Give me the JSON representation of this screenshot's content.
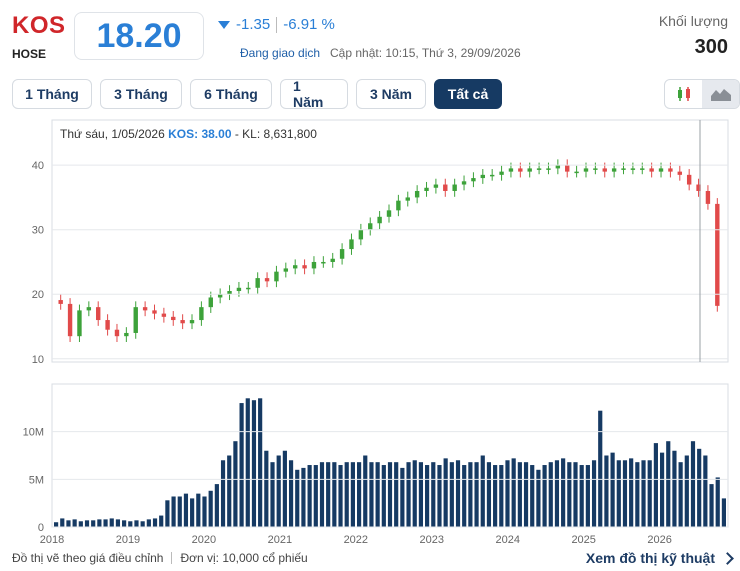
{
  "header": {
    "ticker": "KOS",
    "exchange": "HOSE",
    "price": "18.20",
    "change": "-1.35",
    "change_pct": "-6.91 %",
    "status": "Đang giao dịch",
    "updated": "Cập nhật: 10:15, Thứ 3, 29/09/2026",
    "volume_label": "Khối lượng",
    "volume_value": "300"
  },
  "tabs": [
    {
      "label": "1 Tháng",
      "active": false
    },
    {
      "label": "3 Tháng",
      "active": false
    },
    {
      "label": "6 Tháng",
      "active": false
    },
    {
      "label": "1 Năm",
      "active": false
    },
    {
      "label": "3 Năm",
      "active": false
    },
    {
      "label": "Tất cả",
      "active": true
    }
  ],
  "chart_toggle": [
    {
      "icon": "candlestick-icon",
      "active": false
    },
    {
      "icon": "area-chart-icon",
      "active": true
    }
  ],
  "tooltip": {
    "date": "Thứ sáu, 1/05/2026",
    "value": "KOS: 38.00",
    "volume": "- KL: 8,631,800"
  },
  "colors": {
    "up": "#3da23a",
    "down": "#e14a4a",
    "volume": "#163a63",
    "accent": "#2a7fd6"
  },
  "chart_data": {
    "type": "candlestick",
    "x": [
      2018.0,
      2018.08,
      2018.17,
      2018.25,
      2018.33,
      2018.42,
      2018.5,
      2018.58,
      2018.67,
      2018.75,
      2018.83,
      2018.92,
      2019.0,
      2019.08,
      2019.17,
      2019.25,
      2019.33,
      2019.42,
      2019.5,
      2019.58,
      2019.67,
      2019.75,
      2019.83,
      2019.92,
      2020.0,
      2020.08,
      2020.17,
      2020.25,
      2020.33,
      2020.42,
      2020.5,
      2020.58,
      2020.67,
      2020.75,
      2020.83,
      2020.92,
      2021.0,
      2021.08,
      2021.17,
      2021.25,
      2021.33,
      2021.42,
      2021.5,
      2021.58,
      2021.67,
      2021.75,
      2021.83,
      2021.92,
      2022.0,
      2022.08,
      2022.17,
      2022.25,
      2022.33,
      2022.42,
      2022.5,
      2022.58,
      2022.67,
      2022.75,
      2022.83,
      2022.92,
      2023.0,
      2023.08,
      2023.17,
      2023.25,
      2023.33,
      2023.42,
      2023.5,
      2023.58,
      2023.67,
      2023.75,
      2023.83,
      2023.92,
      2024.0,
      2024.08,
      2024.17,
      2024.25,
      2024.33,
      2024.42,
      2024.5,
      2024.58,
      2024.67,
      2024.75,
      2024.83,
      2024.92,
      2025.0,
      2025.08,
      2025.17,
      2025.25,
      2025.33,
      2025.42,
      2025.5,
      2025.58,
      2025.67,
      2025.75,
      2025.83,
      2025.92,
      2026.0,
      2026.08,
      2026.17,
      2026.25,
      2026.33,
      2026.42,
      2026.5,
      2026.58,
      2026.67,
      2026.75
    ],
    "close": [
      18.5,
      13.5,
      17.5,
      18.0,
      16.0,
      14.5,
      13.5,
      14.0,
      18.0,
      17.5,
      17.0,
      16.5,
      16.0,
      15.5,
      16.0,
      18.0,
      19.5,
      20.0,
      20.5,
      21.0,
      21.0,
      22.5,
      22.0,
      23.5,
      24.0,
      24.5,
      24.0,
      25.0,
      25.0,
      25.5,
      27.0,
      28.5,
      30.0,
      31.0,
      32.0,
      33.0,
      34.5,
      35.0,
      36.0,
      36.5,
      37.0,
      36.0,
      37.0,
      37.5,
      38.0,
      38.5,
      38.5,
      39.0,
      39.5,
      39.0,
      39.5,
      39.5,
      39.5,
      40.0,
      39.0,
      39.0,
      39.5,
      39.5,
      39.0,
      39.5,
      39.5,
      39.5,
      39.5,
      39.0,
      39.5,
      39.0,
      38.5,
      37.0,
      36.0,
      34.0,
      18.2
    ],
    "note_x_ticks": [
      "2018",
      "2019",
      "2020",
      "2021",
      "2022",
      "2023",
      "2024",
      "2025",
      "2026"
    ],
    "y_ticks": [
      "10",
      "20",
      "30",
      "40"
    ],
    "volume_ticks": [
      "0",
      "5M",
      "10M"
    ],
    "volumes": [
      0.5,
      0.9,
      0.7,
      0.8,
      0.6,
      0.7,
      0.7,
      0.8,
      0.8,
      0.9,
      0.8,
      0.7,
      0.6,
      0.7,
      0.6,
      0.8,
      0.9,
      1.2,
      2.8,
      3.2,
      3.2,
      3.5,
      3.0,
      3.5,
      3.2,
      3.8,
      4.5,
      7.0,
      7.5,
      9.0,
      13.0,
      13.5,
      13.3,
      13.5,
      8.0,
      6.8,
      7.5,
      8.0,
      7.0,
      6.0,
      6.2,
      6.5,
      6.5,
      6.8,
      6.8,
      6.8,
      6.5,
      6.8,
      6.8,
      6.8,
      7.5,
      6.8,
      6.8,
      6.5,
      6.8,
      6.8,
      6.2,
      6.8,
      7.0,
      6.8,
      6.5,
      6.8,
      6.5,
      7.2,
      6.8,
      7.0,
      6.5,
      6.8,
      6.8,
      7.5,
      6.8,
      6.5,
      6.5,
      7.0,
      7.2,
      6.8,
      6.8,
      6.5,
      6.0,
      6.5,
      6.8,
      7.0,
      7.2,
      6.8,
      6.8,
      6.5,
      6.5,
      7.0,
      12.2,
      7.5,
      7.8,
      7.0,
      7.0,
      7.2,
      6.8,
      7.0,
      7.0,
      8.8,
      7.8,
      9.0,
      8.0,
      6.8,
      7.5,
      9.0,
      8.2,
      7.5,
      4.5,
      5.2,
      3.0
    ]
  },
  "footer": {
    "note1": "Đồ thị vẽ theo giá điều chỉnh",
    "note2": "Đơn vị: 10,000 cổ phiếu",
    "link": "Xem đồ thị kỹ thuật"
  }
}
